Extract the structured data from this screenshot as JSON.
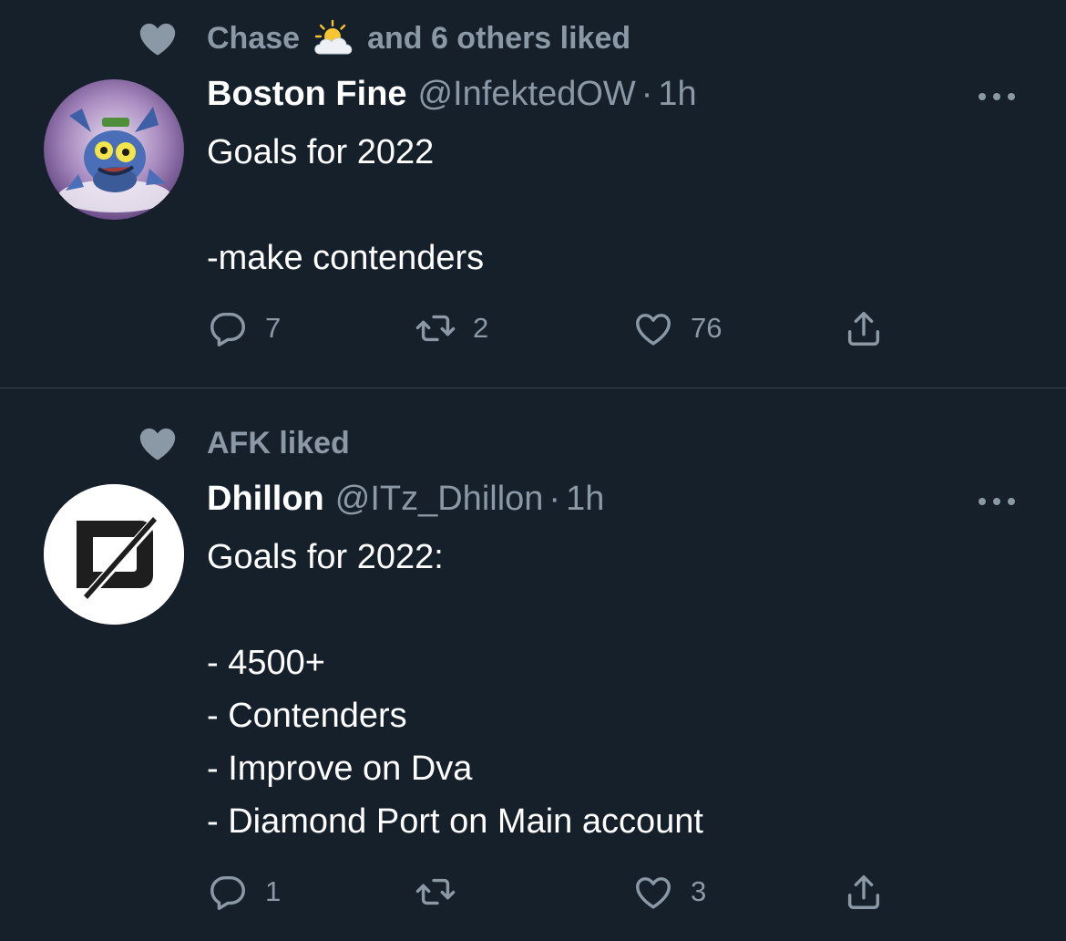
{
  "colors": {
    "background": "#15202b",
    "secondary_text": "#8b98a5",
    "primary_text": "#ffffff",
    "divider": "#38444d"
  },
  "tweets": [
    {
      "social": {
        "icon": "heart-icon",
        "prefix": "Chase",
        "emoji": "sun-behind-cloud-icon",
        "suffix": "and 6 others liked"
      },
      "author": {
        "name": "Boston Fine",
        "handle": "@InfektedOW",
        "separator": "·",
        "time": "1h",
        "avatar": "creature-avatar"
      },
      "lines": [
        "Goals for 2022",
        "",
        "-make contenders"
      ],
      "actions": {
        "reply": "7",
        "retweet": "2",
        "like": "76",
        "share": ""
      }
    },
    {
      "social": {
        "icon": "heart-icon",
        "text": "AFK liked"
      },
      "author": {
        "name": "Dhillon",
        "handle": "@ITz_Dhillon",
        "separator": "·",
        "time": "1h",
        "avatar": "d-logo-avatar"
      },
      "lines": [
        "Goals for 2022:",
        "",
        "- 4500+",
        "- Contenders",
        "- Improve on Dva",
        "- Diamond Port on Main account"
      ],
      "actions": {
        "reply": "1",
        "retweet": "",
        "like": "3",
        "share": ""
      }
    }
  ]
}
